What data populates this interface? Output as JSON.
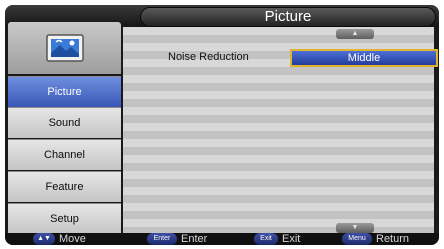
{
  "header": {
    "title": "Picture"
  },
  "sidebar": {
    "items": [
      {
        "label": "Picture",
        "active": true
      },
      {
        "label": "Sound",
        "active": false
      },
      {
        "label": "Channel",
        "active": false
      },
      {
        "label": "Feature",
        "active": false
      },
      {
        "label": "Setup",
        "active": false
      }
    ]
  },
  "panel": {
    "settings": [
      {
        "label": "Noise Reduction",
        "value": "Middle"
      }
    ],
    "scroll_up_glyph": "▲",
    "scroll_down_glyph": "▼"
  },
  "footer": {
    "hints": [
      {
        "key": "▲▼",
        "label": "Move"
      },
      {
        "key": "Enter",
        "label": "Enter"
      },
      {
        "key": "Exit",
        "label": "Exit"
      },
      {
        "key": "Menu",
        "label": "Return"
      }
    ]
  },
  "colors": {
    "active_item": "#4a6ad0",
    "highlight_border": "#e0b42c",
    "frame": "#1a1a1a"
  }
}
